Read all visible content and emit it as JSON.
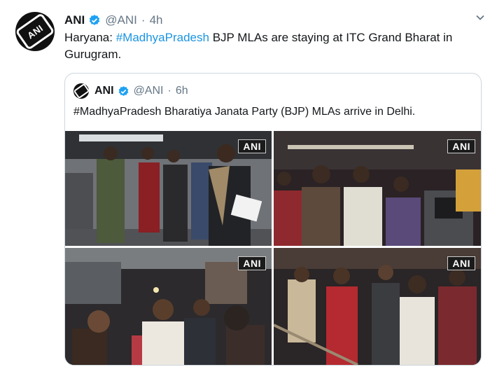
{
  "tweet": {
    "author_name": "ANI",
    "handle": "@ANI",
    "separator": "·",
    "time": "4h",
    "text_prefix": "Haryana: ",
    "hashtag": "#MadhyaPradesh",
    "text_suffix": " BJP MLAs are staying at ITC Grand Bharat in Gurugram."
  },
  "quoted": {
    "author_name": "ANI",
    "handle": "@ANI",
    "separator": "·",
    "time": "6h",
    "text": "#MadhyaPradesh Bharatiya Janata Party (BJP) MLAs arrive in Delhi."
  },
  "photos": [
    {
      "badge": "ANI"
    },
    {
      "badge": "ANI"
    },
    {
      "badge": "ANI"
    },
    {
      "badge": "ANI"
    }
  ],
  "logo_text": "ANI",
  "icons": {
    "verified": "verified-badge-icon",
    "menu": "chevron-down-icon"
  },
  "colors": {
    "link": "#1b95e0",
    "verified": "#1da1f2",
    "muted": "#657786",
    "border": "#ccd6dd"
  }
}
